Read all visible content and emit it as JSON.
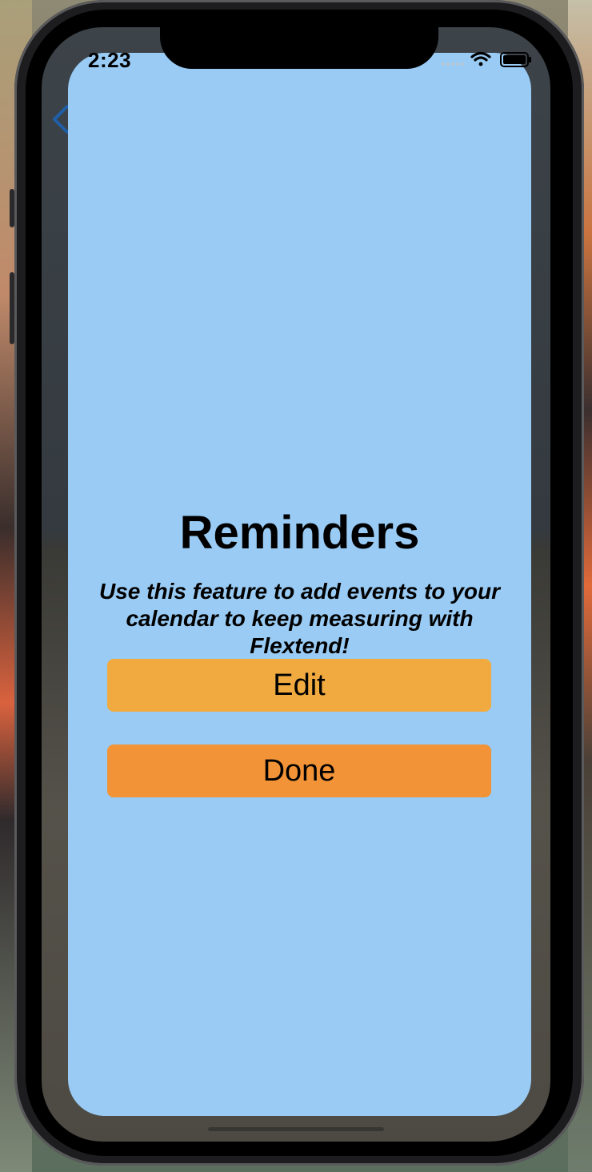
{
  "status_bar": {
    "time": "2:23",
    "icons": [
      "signal-icon",
      "wifi-icon",
      "battery-icon"
    ]
  },
  "sheet": {
    "title": "Reminders",
    "description": "Use this feature to add events to your calendar to keep measuring with Flextend!",
    "edit_label": "Edit",
    "done_label": "Done"
  },
  "colors": {
    "sheet_background": "#99cbf4",
    "edit_button": "#f0aa3f",
    "done_button": "#f19336",
    "back_chevron": "#1f5fa8"
  }
}
